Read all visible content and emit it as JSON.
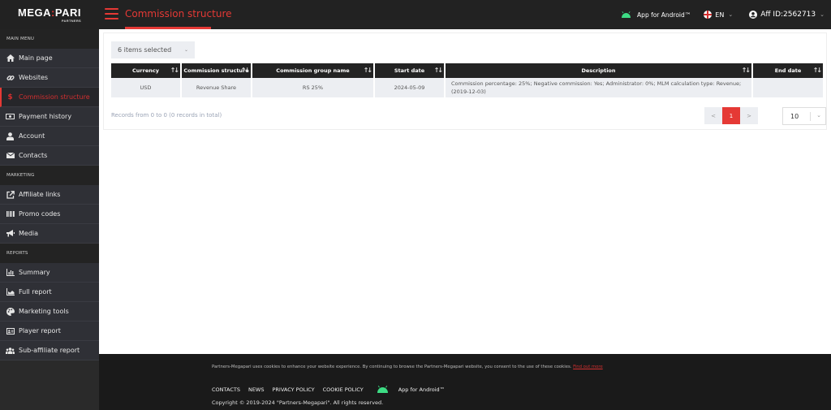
{
  "header": {
    "logo_left": "MEGA",
    "logo_sep": ":",
    "logo_right": "PARI",
    "logo_sub": "PARTNERS",
    "page_title": "Commission structure",
    "app_android": "App for Android™",
    "language": "EN",
    "affiliate_id": "Aff ID:2562713"
  },
  "sidebar": {
    "sections": [
      {
        "title": "MAIN MENU",
        "items": [
          {
            "label": "Main page",
            "icon": "home-icon"
          },
          {
            "label": "Websites",
            "icon": "link-icon"
          },
          {
            "label": "Commission structure",
            "icon": "dollar-icon",
            "active": true
          },
          {
            "label": "Payment history",
            "icon": "money-bill-icon"
          },
          {
            "label": "Account",
            "icon": "user-icon"
          },
          {
            "label": "Contacts",
            "icon": "envelope-icon"
          }
        ]
      },
      {
        "title": "MARKETING",
        "items": [
          {
            "label": "Affiliate links",
            "icon": "external-link-icon"
          },
          {
            "label": "Promo codes",
            "icon": "barcode-icon"
          },
          {
            "label": "Media",
            "icon": "megaphone-icon"
          }
        ]
      },
      {
        "title": "REPORTS",
        "items": [
          {
            "label": "Summary",
            "icon": "bar-chart-icon"
          },
          {
            "label": "Full report",
            "icon": "area-chart-icon"
          },
          {
            "label": "Marketing tools",
            "icon": "palette-icon"
          },
          {
            "label": "Player report",
            "icon": "id-card-icon"
          },
          {
            "label": "Sub-affiliate report",
            "icon": "users-icon"
          }
        ]
      }
    ]
  },
  "main": {
    "column_filter": "6 items selected",
    "table": {
      "columns": [
        "Currency",
        "Commission structure",
        "Commission group name",
        "Start date",
        "Description",
        "End date"
      ],
      "rows": [
        [
          "USD",
          "Revenue Share",
          "RS 25%",
          "2024-05-09",
          "Commission percentage: 25%; Negative commission: Yes; Administrator: 0%; MLM calculation type: Revenue; (2019-12-03)",
          ""
        ]
      ]
    },
    "records_text": "Records from 0 to 0 (0 records in total)",
    "pagination": {
      "prev": "<",
      "current_page": "1",
      "next": ">",
      "page_size": "10"
    }
  },
  "footer": {
    "cookie_text": "Partners-Megapari uses cookies to enhance your website experience. By continuing to browse the Partners-Megapari website, you consent to the use of these cookies.",
    "cookie_link": "Find out more",
    "links": [
      "CONTACTS",
      "NEWS",
      "PRIVACY POLICY",
      "COOKIE POLICY"
    ],
    "app_android": "App for Android™",
    "copyright": "Copyright © 2019-2024 \"Partners-Megapari\". All rights reserved."
  },
  "colors": {
    "accent": "#e53935",
    "topbar": "#222222",
    "sidebar": "#2f3036",
    "android_green": "#3ddc84"
  }
}
